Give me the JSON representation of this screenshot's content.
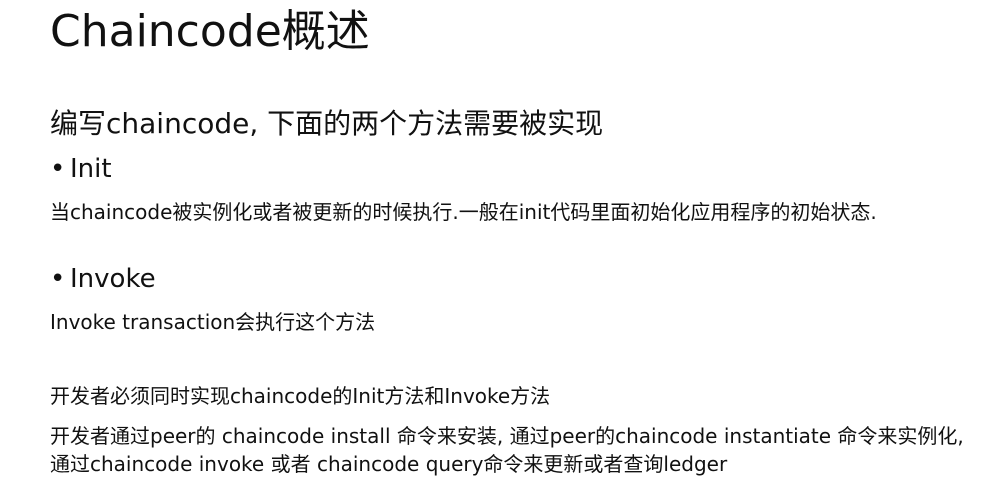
{
  "slide": {
    "title": "Chaincode概述",
    "intro": "编写chaincode, 下面的两个方法需要被实现",
    "bullets": [
      {
        "marker": "•",
        "label": "Init",
        "description": "当chaincode被实例化或者被更新的时候执行.一般在init代码里面初始化应用程序的初始状态."
      },
      {
        "marker": "•",
        "label": "Invoke",
        "description": "Invoke transaction会执行这个方法"
      }
    ],
    "requirement": "开发者必须同时实现chaincode的Init方法和Invoke方法",
    "commands": "开发者通过peer的 chaincode install 命令来安装, 通过peer的chaincode instantiate 命令来实例化, 通过chaincode invoke 或者 chaincode query命令来更新或者查询ledger"
  }
}
